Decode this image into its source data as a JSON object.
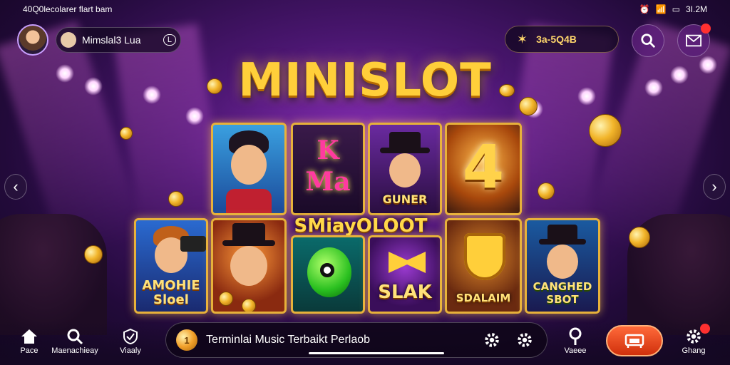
{
  "status_bar": {
    "left_text": "40Q0lecolarer flart bam",
    "right_text": "3I.2M"
  },
  "header": {
    "profile_name": "Mimslal3 Lua",
    "profile_badge": "L",
    "coin_balance": "3a-5Q4B"
  },
  "title": "MINISLOT",
  "tiles": [
    {
      "label": "",
      "theme": "hero"
    },
    {
      "label": "K\nMa",
      "theme": "letters"
    },
    {
      "label": "GUNER",
      "theme": "tophat"
    },
    {
      "label": "4",
      "theme": "number"
    },
    {
      "label": "AMOHIE\nSloel",
      "theme": "camera"
    },
    {
      "label": "",
      "theme": "magician"
    },
    {
      "label": "",
      "theme": "green-orb"
    },
    {
      "label": "SLAK",
      "theme": "bow"
    },
    {
      "label": "SDALAIM",
      "theme": "shield"
    },
    {
      "label": "CANGHED\nSBOT",
      "theme": "feather"
    }
  ],
  "center_banner": "SMiayOLOOT",
  "bottom_nav": [
    {
      "label": "Pace",
      "icon": "home-icon"
    },
    {
      "label": "Maenachieay",
      "icon": "search-icon"
    },
    {
      "label": "Viaaly",
      "icon": "shield-icon"
    },
    {
      "label": "Vaeee",
      "icon": "pin-icon"
    },
    {
      "label": "Ghang",
      "icon": "gear-badge-icon"
    }
  ],
  "ticker": {
    "coin_label": "1",
    "text": "Terminlai Music Terbaikt Perlaob"
  },
  "colors": {
    "gold": "#ffcf3a",
    "accent_orange": "#e0451c",
    "purple_bg": "#4a1670"
  }
}
